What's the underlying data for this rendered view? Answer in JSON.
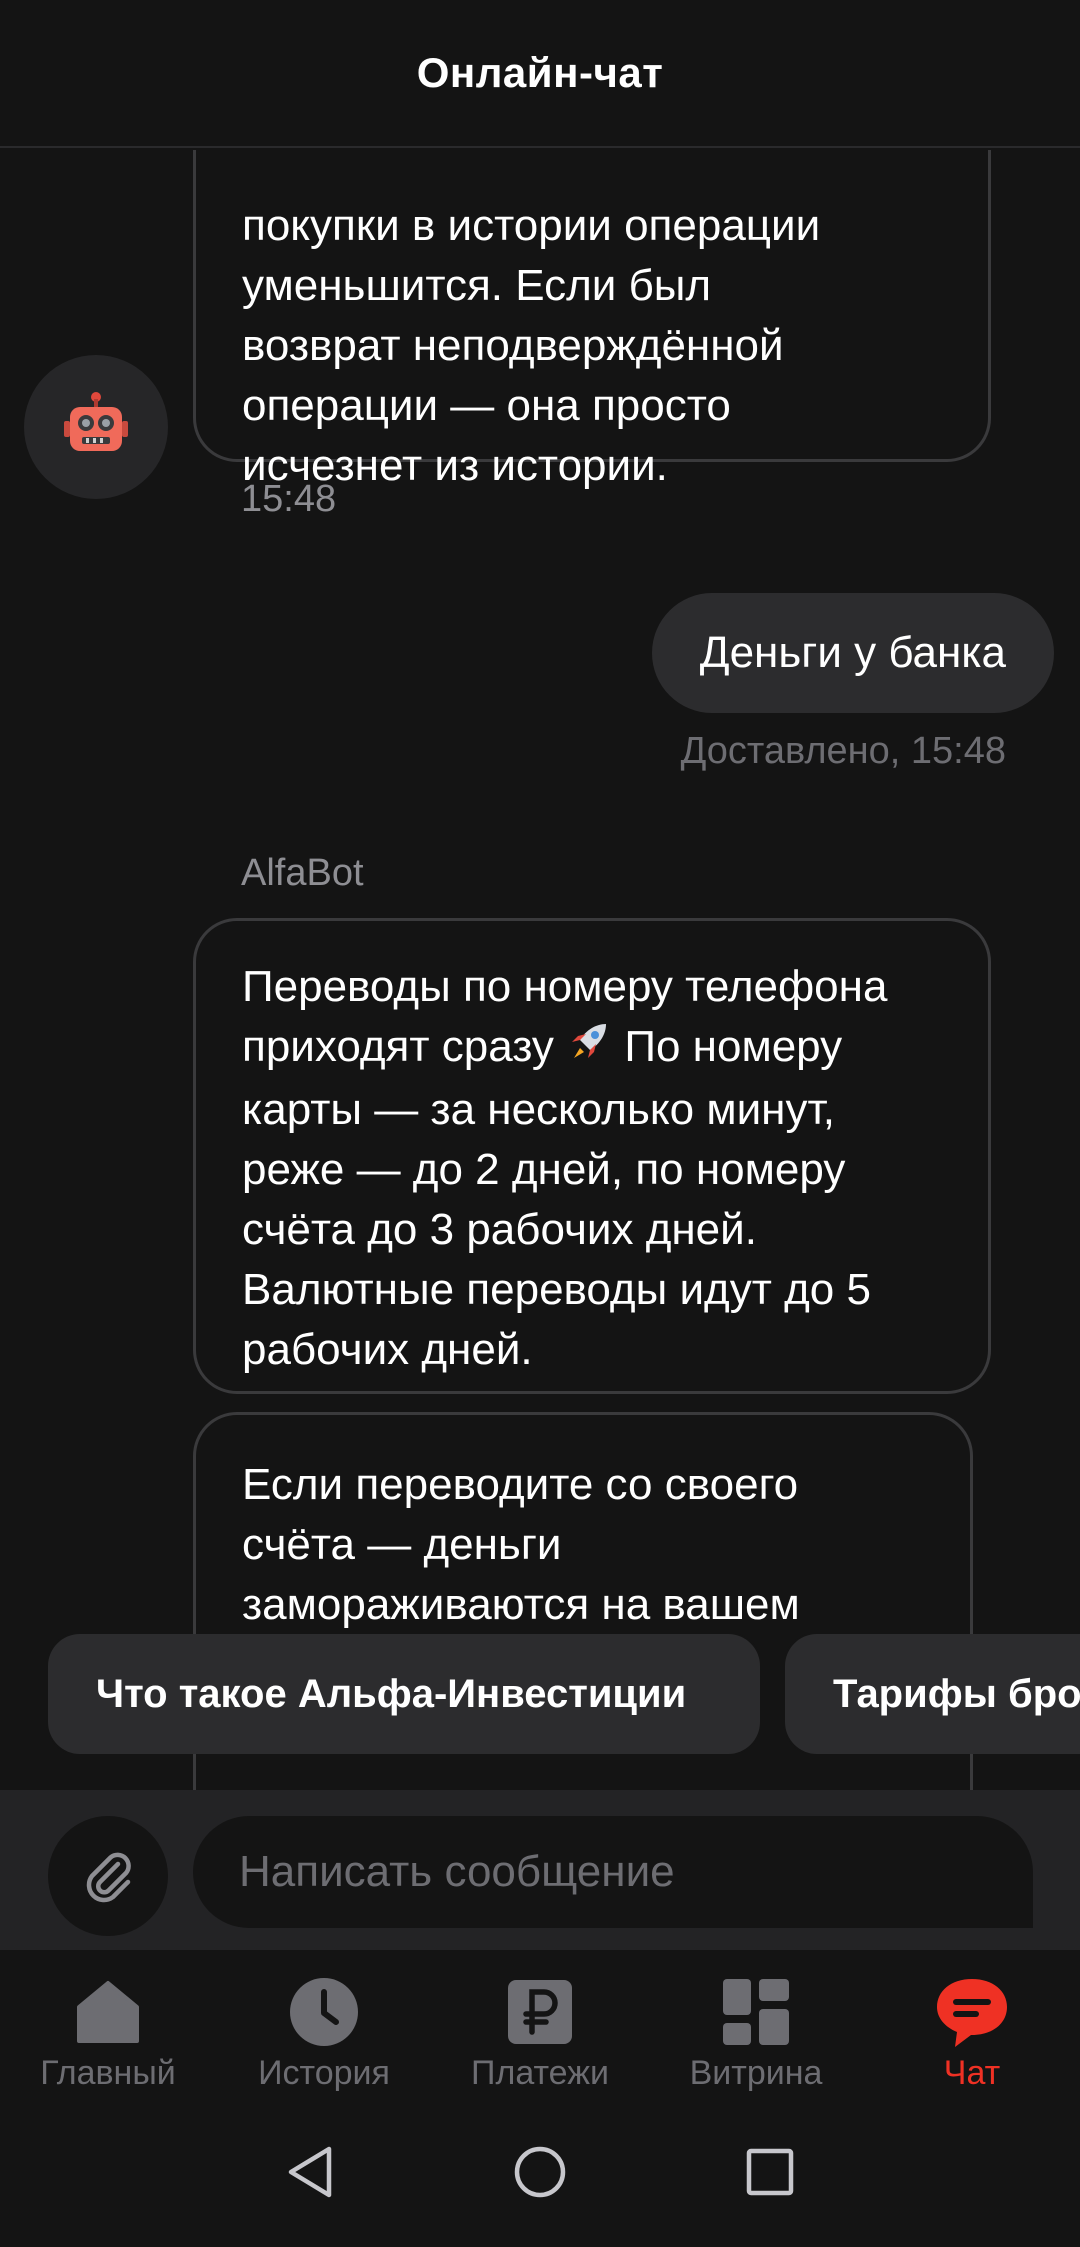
{
  "header": {
    "title": "Онлайн-чат"
  },
  "messages": {
    "bot_first": {
      "text": "покупки в истории операции\nуменьшится. Если был\nвозврат неподверждённой\nоперации — она просто\nисчезнет из истории.",
      "time": "15:48"
    },
    "user": {
      "text": "Деньги у банка",
      "status": "Доставлено, 15:48"
    },
    "sender": "AlfaBot",
    "bot_second": {
      "part1": "Переводы по номеру телефона\nприходят сразу",
      "part2": " По номеру\nкарты — за несколько минут,\nреже — до 2 дней, по номеру\nсчёта до 3 рабочих дней.\nВалютные переводы идут до 5\nрабочих дней."
    },
    "bot_third": {
      "text": "Если переводите со своего\nсчёта — деньги\nзамораживаются на вашем"
    }
  },
  "suggestions": [
    "Что такое Альфа-Инвестиции",
    "Тарифы бро"
  ],
  "composer": {
    "placeholder": "Написать сообщение"
  },
  "tabs": [
    {
      "label": "Главный",
      "icon": "home-icon",
      "active": false
    },
    {
      "label": "История",
      "icon": "clock-icon",
      "active": false
    },
    {
      "label": "Платежи",
      "icon": "ruble-icon",
      "active": false
    },
    {
      "label": "Витрина",
      "icon": "grid-icon",
      "active": false
    },
    {
      "label": "Чат",
      "icon": "chat-icon",
      "active": true
    }
  ],
  "colors": {
    "accent": "#ef3124",
    "background": "#141414",
    "muted": "#6d6d72"
  }
}
